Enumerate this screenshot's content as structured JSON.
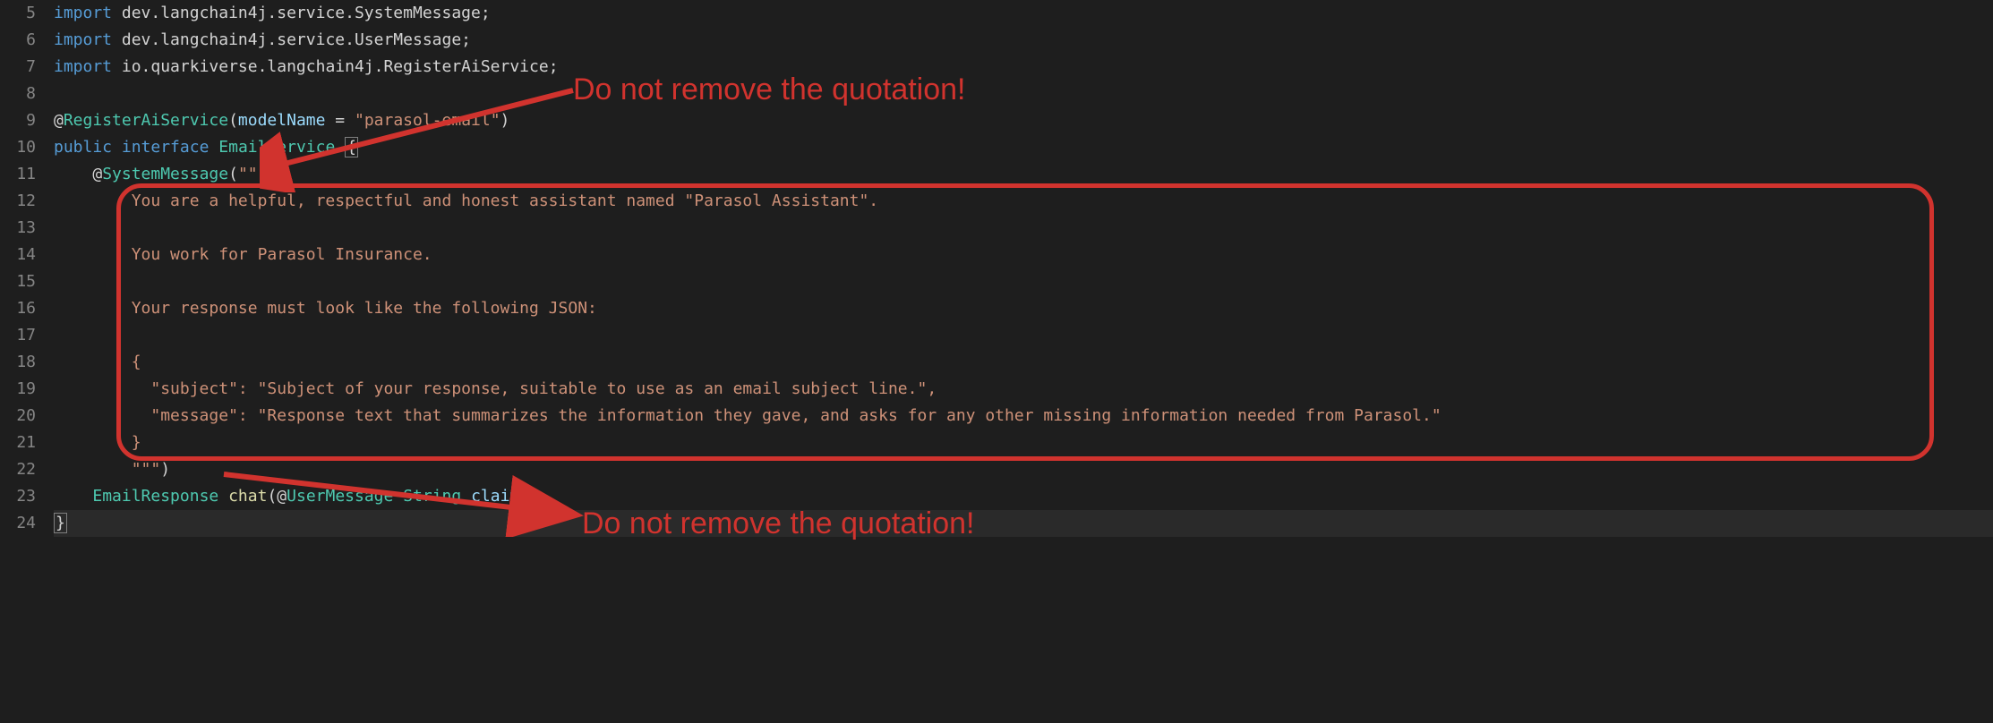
{
  "line_numbers": [
    "5",
    "6",
    "7",
    "8",
    "9",
    "10",
    "11",
    "12",
    "13",
    "14",
    "15",
    "16",
    "17",
    "18",
    "19",
    "20",
    "21",
    "22",
    "23",
    "24"
  ],
  "code": {
    "l5": {
      "kw": "import",
      "rest": " dev.langchain4j.service.SystemMessage;"
    },
    "l6": {
      "kw": "import",
      "rest": " dev.langchain4j.service.UserMessage;"
    },
    "l7": {
      "kw": "import",
      "rest": " io.quarkiverse.langchain4j.RegisterAiService;"
    },
    "l8": "",
    "l9": {
      "at": "@",
      "ann": "RegisterAiService",
      "open": "(",
      "param": "modelName",
      "eq": " = ",
      "str": "\"parasol-email\"",
      "close": ")"
    },
    "l10": {
      "kw1": "public",
      "sp1": " ",
      "kw2": "interface",
      "sp2": " ",
      "type": "EmailService",
      "sp3": " ",
      "brace": "{"
    },
    "l11": {
      "indent": "    ",
      "at": "@",
      "ann": "SystemMessage",
      "open": "(",
      "str": "\"\"\""
    },
    "l12": "        You are a helpful, respectful and honest assistant named \"Parasol Assistant\".",
    "l13": "",
    "l14": "        You work for Parasol Insurance.",
    "l15": "",
    "l16": "        Your response must look like the following JSON:",
    "l17": "",
    "l18": "        {",
    "l19": "          \"subject\": \"Subject of your response, suitable to use as an email subject line.\",",
    "l20": "          \"message\": \"Response text that summarizes the information they gave, and asks for any other missing information needed from Parasol.\"",
    "l21": "        }",
    "l22": {
      "indent": "        ",
      "str": "\"\"\"",
      "close": ")"
    },
    "l23": {
      "indent": "    ",
      "type": "EmailResponse",
      "sp": " ",
      "fn": "chat",
      "open": "(",
      "at": "@",
      "ann": "UserMessage",
      "sp2": " ",
      "ptype": "String",
      "sp3": " ",
      "pname": "claim",
      "close": ");"
    },
    "l24": "}"
  },
  "annotations": {
    "callout_top": "Do not remove the quotation!",
    "callout_bottom": "Do not remove the quotation!"
  },
  "colors": {
    "annotation_red": "#d1332e",
    "editor_bg": "#1e1e1e"
  }
}
